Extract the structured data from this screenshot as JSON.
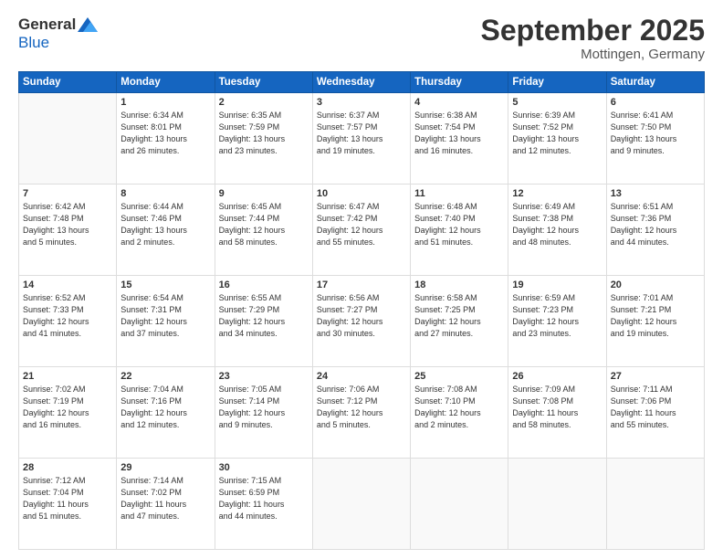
{
  "header": {
    "logo_general": "General",
    "logo_blue": "Blue",
    "month_title": "September 2025",
    "location": "Mottingen, Germany"
  },
  "days_of_week": [
    "Sunday",
    "Monday",
    "Tuesday",
    "Wednesday",
    "Thursday",
    "Friday",
    "Saturday"
  ],
  "weeks": [
    [
      {
        "day": "",
        "info": ""
      },
      {
        "day": "1",
        "info": "Sunrise: 6:34 AM\nSunset: 8:01 PM\nDaylight: 13 hours\nand 26 minutes."
      },
      {
        "day": "2",
        "info": "Sunrise: 6:35 AM\nSunset: 7:59 PM\nDaylight: 13 hours\nand 23 minutes."
      },
      {
        "day": "3",
        "info": "Sunrise: 6:37 AM\nSunset: 7:57 PM\nDaylight: 13 hours\nand 19 minutes."
      },
      {
        "day": "4",
        "info": "Sunrise: 6:38 AM\nSunset: 7:54 PM\nDaylight: 13 hours\nand 16 minutes."
      },
      {
        "day": "5",
        "info": "Sunrise: 6:39 AM\nSunset: 7:52 PM\nDaylight: 13 hours\nand 12 minutes."
      },
      {
        "day": "6",
        "info": "Sunrise: 6:41 AM\nSunset: 7:50 PM\nDaylight: 13 hours\nand 9 minutes."
      }
    ],
    [
      {
        "day": "7",
        "info": "Sunrise: 6:42 AM\nSunset: 7:48 PM\nDaylight: 13 hours\nand 5 minutes."
      },
      {
        "day": "8",
        "info": "Sunrise: 6:44 AM\nSunset: 7:46 PM\nDaylight: 13 hours\nand 2 minutes."
      },
      {
        "day": "9",
        "info": "Sunrise: 6:45 AM\nSunset: 7:44 PM\nDaylight: 12 hours\nand 58 minutes."
      },
      {
        "day": "10",
        "info": "Sunrise: 6:47 AM\nSunset: 7:42 PM\nDaylight: 12 hours\nand 55 minutes."
      },
      {
        "day": "11",
        "info": "Sunrise: 6:48 AM\nSunset: 7:40 PM\nDaylight: 12 hours\nand 51 minutes."
      },
      {
        "day": "12",
        "info": "Sunrise: 6:49 AM\nSunset: 7:38 PM\nDaylight: 12 hours\nand 48 minutes."
      },
      {
        "day": "13",
        "info": "Sunrise: 6:51 AM\nSunset: 7:36 PM\nDaylight: 12 hours\nand 44 minutes."
      }
    ],
    [
      {
        "day": "14",
        "info": "Sunrise: 6:52 AM\nSunset: 7:33 PM\nDaylight: 12 hours\nand 41 minutes."
      },
      {
        "day": "15",
        "info": "Sunrise: 6:54 AM\nSunset: 7:31 PM\nDaylight: 12 hours\nand 37 minutes."
      },
      {
        "day": "16",
        "info": "Sunrise: 6:55 AM\nSunset: 7:29 PM\nDaylight: 12 hours\nand 34 minutes."
      },
      {
        "day": "17",
        "info": "Sunrise: 6:56 AM\nSunset: 7:27 PM\nDaylight: 12 hours\nand 30 minutes."
      },
      {
        "day": "18",
        "info": "Sunrise: 6:58 AM\nSunset: 7:25 PM\nDaylight: 12 hours\nand 27 minutes."
      },
      {
        "day": "19",
        "info": "Sunrise: 6:59 AM\nSunset: 7:23 PM\nDaylight: 12 hours\nand 23 minutes."
      },
      {
        "day": "20",
        "info": "Sunrise: 7:01 AM\nSunset: 7:21 PM\nDaylight: 12 hours\nand 19 minutes."
      }
    ],
    [
      {
        "day": "21",
        "info": "Sunrise: 7:02 AM\nSunset: 7:19 PM\nDaylight: 12 hours\nand 16 minutes."
      },
      {
        "day": "22",
        "info": "Sunrise: 7:04 AM\nSunset: 7:16 PM\nDaylight: 12 hours\nand 12 minutes."
      },
      {
        "day": "23",
        "info": "Sunrise: 7:05 AM\nSunset: 7:14 PM\nDaylight: 12 hours\nand 9 minutes."
      },
      {
        "day": "24",
        "info": "Sunrise: 7:06 AM\nSunset: 7:12 PM\nDaylight: 12 hours\nand 5 minutes."
      },
      {
        "day": "25",
        "info": "Sunrise: 7:08 AM\nSunset: 7:10 PM\nDaylight: 12 hours\nand 2 minutes."
      },
      {
        "day": "26",
        "info": "Sunrise: 7:09 AM\nSunset: 7:08 PM\nDaylight: 11 hours\nand 58 minutes."
      },
      {
        "day": "27",
        "info": "Sunrise: 7:11 AM\nSunset: 7:06 PM\nDaylight: 11 hours\nand 55 minutes."
      }
    ],
    [
      {
        "day": "28",
        "info": "Sunrise: 7:12 AM\nSunset: 7:04 PM\nDaylight: 11 hours\nand 51 minutes."
      },
      {
        "day": "29",
        "info": "Sunrise: 7:14 AM\nSunset: 7:02 PM\nDaylight: 11 hours\nand 47 minutes."
      },
      {
        "day": "30",
        "info": "Sunrise: 7:15 AM\nSunset: 6:59 PM\nDaylight: 11 hours\nand 44 minutes."
      },
      {
        "day": "",
        "info": ""
      },
      {
        "day": "",
        "info": ""
      },
      {
        "day": "",
        "info": ""
      },
      {
        "day": "",
        "info": ""
      }
    ]
  ]
}
